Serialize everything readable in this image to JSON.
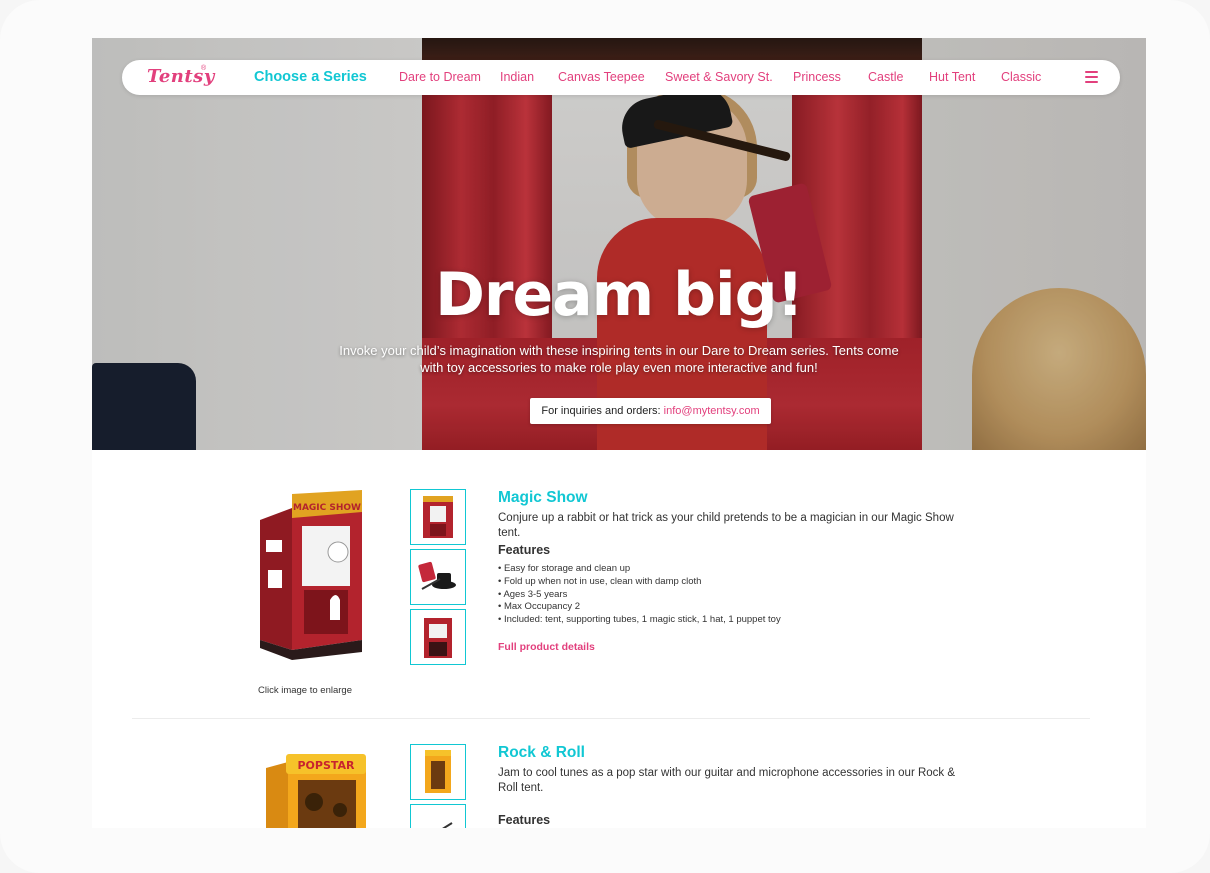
{
  "brand": {
    "logo_text": "Tentsy",
    "logo_mark": "®"
  },
  "nav": {
    "choose_label": "Choose a Series",
    "links": [
      "Dare to Dream",
      "Indian",
      "Canvas Teepee",
      "Sweet & Savory St.",
      "Princess",
      "Castle",
      "Hut Tent",
      "Classic"
    ],
    "menu_icon": "hamburger-menu-icon"
  },
  "hero": {
    "title": "Dream big!",
    "subtitle": "Invoke your child’s imagination with these inspiring tents in our Dare to Dream series. Tents come with toy accessories to make role play even more interactive and fun!",
    "inquiry_label": "For inquiries and orders:",
    "inquiry_email": "info@mytentsy.com"
  },
  "products": [
    {
      "title": "Magic Show",
      "description": "Conjure up a rabbit or hat trick as your child pretends to be a magician in our Magic Show tent.",
      "features_heading": "Features",
      "features": [
        "• Easy for storage and clean up",
        "• Fold up when not in use, clean with damp cloth",
        "• Ages 3-5 years",
        "• Max Occupancy 2",
        "• Included: tent, supporting tubes, 1 magic stick, 1 hat, 1 puppet toy"
      ],
      "details_link": "Full product details",
      "enlarge_hint": "Click image to enlarge",
      "tent_sign": "MAGIC SHOW"
    },
    {
      "title": "Rock & Roll",
      "description": "Jam to cool tunes as a pop star with our guitar and microphone accessories in our Rock & Roll tent.",
      "features_heading": "Features",
      "tent_sign": "POPSTAR"
    }
  ],
  "colors": {
    "accent_pink": "#e2407d",
    "accent_cyan": "#11c7d3"
  }
}
